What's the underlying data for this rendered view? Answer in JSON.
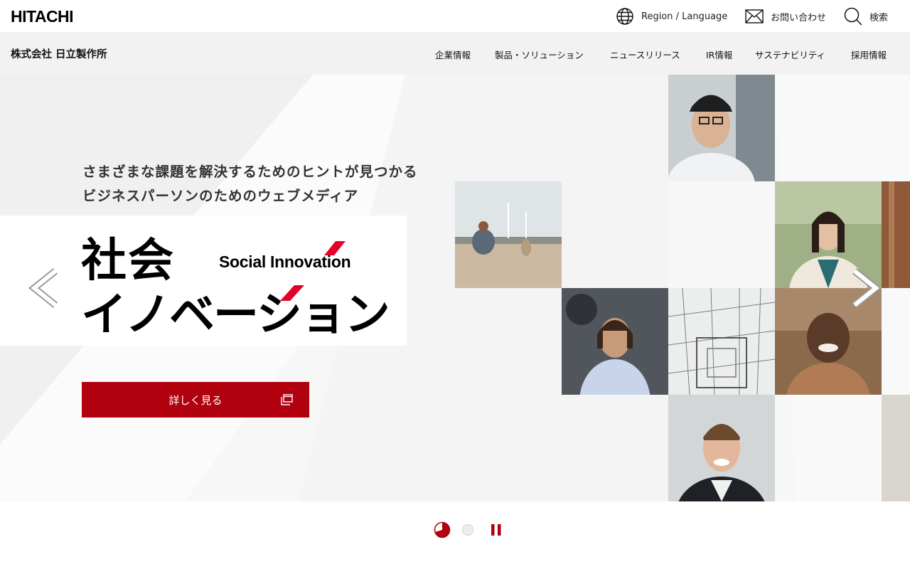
{
  "header": {
    "logo": "HITACHI",
    "region_label": "Region / Language",
    "contact_label": "お問い合わせ",
    "search_label": "検索"
  },
  "nav": {
    "corp_name": "株式会社 日立製作所",
    "items": [
      "企業情報",
      "製品・ソリューション",
      "ニュースリリース",
      "IR情報",
      "サステナビリティ",
      "採用情報"
    ]
  },
  "hero": {
    "tagline_line1": "さまざまな課題を解決するためのヒントが見つかる",
    "tagline_line2": "ビジネスパーソンのためのウェブメディア",
    "title_line1": "社会",
    "title_line2": "イノベーション",
    "title_en": "Social Innovation",
    "cta_label": "詳しく見る"
  },
  "icons": {
    "region": "globe-icon",
    "contact": "mail-icon",
    "search": "search-icon",
    "prev": "chevron-left-icon",
    "next": "chevron-right-icon",
    "external": "external-window-icon",
    "pause": "pause-icon"
  },
  "colors": {
    "accent": "#b1000e",
    "slash_red": "#e60027",
    "nav_bg": "#f2f2f2"
  }
}
